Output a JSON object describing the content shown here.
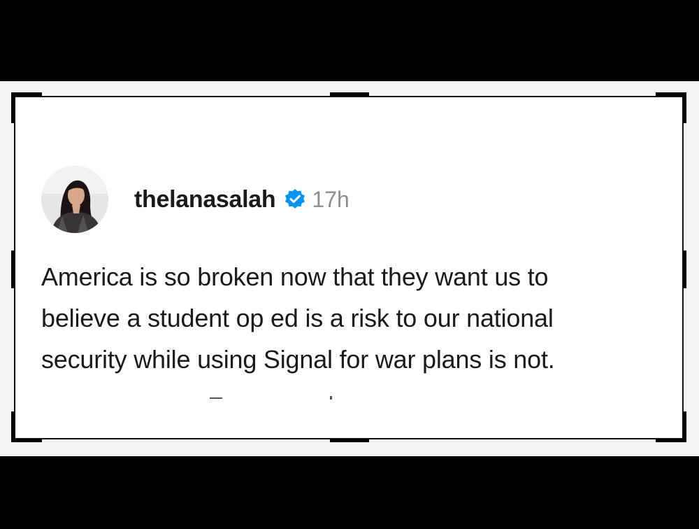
{
  "post": {
    "username": "thelanasalah",
    "verified": true,
    "timestamp": "17h",
    "lines": [
      "America is so broken now that they want us to",
      "believe a student op ed is a risk to our national",
      "security while using Signal for war plans is not."
    ]
  },
  "icons": {
    "verified_badge": "verified-badge-icon",
    "avatar": "profile-photo"
  },
  "colors": {
    "verified_blue": "#0095f6",
    "timestamp_gray": "#8e8e8e",
    "text": "#1a1a1a",
    "frame": "#000000"
  }
}
